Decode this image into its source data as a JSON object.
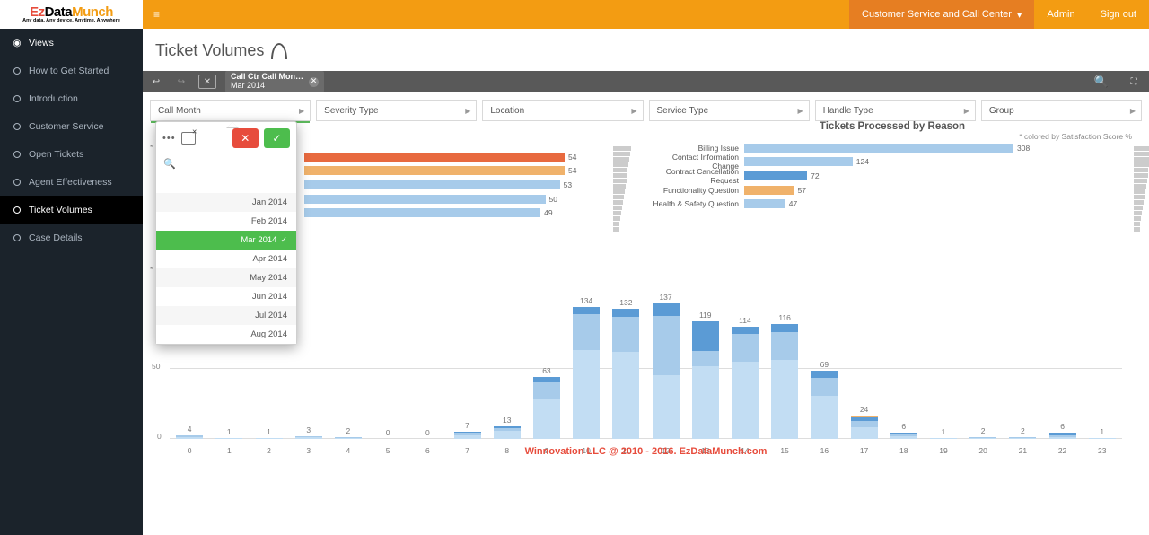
{
  "brand": {
    "line1_ez": "Ez",
    "line1_data": "Data",
    "line1_munch": "Munch",
    "line2": "Any data, Any device, Anytime, Anywhere"
  },
  "topbar": {
    "pill": "Customer Service and Call Center",
    "admin": "Admin",
    "signout": "Sign out"
  },
  "sidebar": {
    "header": "Views",
    "items": [
      {
        "label": "How to Get Started"
      },
      {
        "label": "Introduction"
      },
      {
        "label": "Customer Service"
      },
      {
        "label": "Open Tickets"
      },
      {
        "label": "Agent Effectiveness"
      },
      {
        "label": "Ticket Volumes",
        "active": true
      },
      {
        "label": "Case Details"
      }
    ]
  },
  "page": {
    "title": "Ticket Volumes"
  },
  "crumb": {
    "label": "Call Ctr Call Mon…",
    "value": "Mar 2014"
  },
  "filters": [
    {
      "label": "Call Month",
      "first": true
    },
    {
      "label": "Severity Type"
    },
    {
      "label": "Location"
    },
    {
      "label": "Service Type"
    },
    {
      "label": "Handle Type"
    },
    {
      "label": "Group"
    }
  ],
  "notes": {
    "left": "* c",
    "bottom": "* c"
  },
  "chart_data": [
    {
      "type": "bar",
      "orientation": "horizontal",
      "title": "",
      "values": [
        54,
        54,
        53,
        50,
        49
      ],
      "colors": [
        "#e86a3f",
        "#f0b26b",
        "#a7cbea",
        "#a7cbea",
        "#a7cbea"
      ]
    },
    {
      "type": "bar",
      "orientation": "horizontal",
      "title": "Tickets Processed by Reason",
      "subtitle": "* colored by Satisfaction Score %",
      "categories": [
        "Billing Issue",
        "Contact Information Change",
        "Contract Cancellation Request",
        "Functionality Question",
        "Health & Safety Question"
      ],
      "values": [
        308,
        124,
        72,
        57,
        47
      ],
      "colors": [
        "#a7cbea",
        "#a7cbea",
        "#5b9bd5",
        "#f0b26b",
        "#a7cbea"
      ]
    },
    {
      "type": "bar",
      "orientation": "vertical",
      "stacked": true,
      "ylabel": "",
      "ylim": [
        0,
        140
      ],
      "yticks": [
        0,
        50
      ],
      "categories": [
        "0",
        "1",
        "2",
        "3",
        "4",
        "5",
        "6",
        "7",
        "8",
        "9",
        "10",
        "11",
        "12",
        "13",
        "14",
        "15",
        "16",
        "17",
        "18",
        "19",
        "20",
        "21",
        "22",
        "23"
      ],
      "totals": [
        4,
        1,
        1,
        3,
        2,
        0,
        0,
        7,
        13,
        63,
        134,
        132,
        137,
        119,
        114,
        116,
        69,
        24,
        6,
        1,
        2,
        2,
        6,
        1
      ],
      "series": [
        {
          "name": "seg1",
          "color": "#c2ddf3",
          "values": [
            2,
            1,
            1,
            2,
            1,
            0,
            0,
            4,
            8,
            40,
            90,
            88,
            65,
            74,
            78,
            80,
            44,
            12,
            3,
            1,
            1,
            1,
            2,
            1
          ]
        },
        {
          "name": "seg2",
          "color": "#a7cbea",
          "values": [
            2,
            0,
            0,
            1,
            1,
            0,
            0,
            2,
            3,
            18,
            36,
            36,
            60,
            15,
            28,
            28,
            18,
            6,
            2,
            0,
            1,
            1,
            2,
            0
          ]
        },
        {
          "name": "seg3",
          "color": "#5b9bd5",
          "values": [
            0,
            0,
            0,
            0,
            0,
            0,
            0,
            1,
            2,
            5,
            8,
            8,
            12,
            30,
            8,
            8,
            7,
            4,
            1,
            0,
            0,
            0,
            2,
            0
          ]
        },
        {
          "name": "seg4",
          "color": "#f0b26b",
          "values": [
            0,
            0,
            0,
            0,
            0,
            0,
            0,
            0,
            0,
            0,
            0,
            0,
            0,
            0,
            0,
            0,
            0,
            2,
            0,
            0,
            0,
            0,
            0,
            0
          ]
        }
      ]
    }
  ],
  "popup": {
    "items": [
      "Jan 2014",
      "Feb 2014",
      "Mar 2014",
      "Apr 2014",
      "May 2014",
      "Jun 2014",
      "Jul 2014",
      "Aug 2014"
    ],
    "selected": "Mar 2014"
  },
  "footer": "Winnovation LLC @ 2010 - 2016. EzDataMunch.com"
}
